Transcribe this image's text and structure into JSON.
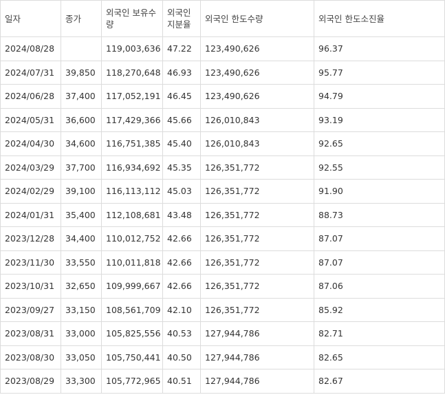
{
  "table": {
    "headers": [
      "일자",
      "종가",
      "외국인 보유수량",
      "외국인 지분율",
      "외국인 한도수량",
      "외국인 한도소진율"
    ],
    "rows": [
      [
        "2024/08/28",
        "",
        "119,003,636",
        "47.22",
        "123,490,626",
        "96.37"
      ],
      [
        "2024/07/31",
        "39,850",
        "118,270,648",
        "46.93",
        "123,490,626",
        "95.77"
      ],
      [
        "2024/06/28",
        "37,400",
        "117,052,191",
        "46.45",
        "123,490,626",
        "94.79"
      ],
      [
        "2024/05/31",
        "36,600",
        "117,429,366",
        "45.66",
        "126,010,843",
        "93.19"
      ],
      [
        "2024/04/30",
        "34,600",
        "116,751,385",
        "45.40",
        "126,010,843",
        "92.65"
      ],
      [
        "2024/03/29",
        "37,700",
        "116,934,692",
        "45.35",
        "126,351,772",
        "92.55"
      ],
      [
        "2024/02/29",
        "39,100",
        "116,113,112",
        "45.03",
        "126,351,772",
        "91.90"
      ],
      [
        "2024/01/31",
        "35,400",
        "112,108,681",
        "43.48",
        "126,351,772",
        "88.73"
      ],
      [
        "2023/12/28",
        "34,400",
        "110,012,752",
        "42.66",
        "126,351,772",
        "87.07"
      ],
      [
        "2023/11/30",
        "33,550",
        "110,011,818",
        "42.66",
        "126,351,772",
        "87.07"
      ],
      [
        "2023/10/31",
        "32,650",
        "109,999,667",
        "42.66",
        "126,351,772",
        "87.06"
      ],
      [
        "2023/09/27",
        "33,150",
        "108,561,709",
        "42.10",
        "126,351,772",
        "85.92"
      ],
      [
        "2023/08/31",
        "33,000",
        "105,825,556",
        "40.53",
        "127,944,786",
        "82.71"
      ],
      [
        "2023/08/30",
        "33,050",
        "105,750,441",
        "40.50",
        "127,944,786",
        "82.65"
      ],
      [
        "2023/08/29",
        "33,300",
        "105,772,965",
        "40.51",
        "127,944,786",
        "82.67"
      ]
    ]
  }
}
